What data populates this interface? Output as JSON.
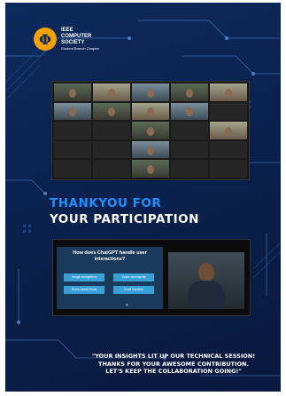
{
  "org": {
    "logo_glyph": "Φ",
    "line1": "IEEE",
    "line2": "COMPUTER",
    "line3": "SOCIETY",
    "line4": "Student Branch Chapter"
  },
  "meeting_grid": {
    "names": [
      "",
      "",
      "",
      "",
      "",
      "",
      "",
      "",
      "",
      "",
      "",
      "",
      "",
      "",
      "",
      "",
      "",
      "",
      "",
      "",
      "",
      "",
      "",
      "",
      ""
    ]
  },
  "headline": {
    "line1": "THANKYOU FOR",
    "line2": "YOUR PARTICIPATION"
  },
  "session_slide": {
    "question": "How does ChatGPT handle user interactions?",
    "options": [
      "Image recognition",
      "Voice commands",
      "Rules-based flows",
      "Code injection"
    ]
  },
  "footer": {
    "line1": "\"YOUR INSIGHTS LIT UP OUR TECHNICAL SESSION!",
    "line2": "THANKS FOR YOUR AWESOME CONTRIBUTION.",
    "line3": "LET'S KEEP THE COLLABORATION GOING!\""
  },
  "colors": {
    "background": "#0a2250",
    "accent_blue": "#1e90ff",
    "logo_orange": "#f5a100"
  }
}
